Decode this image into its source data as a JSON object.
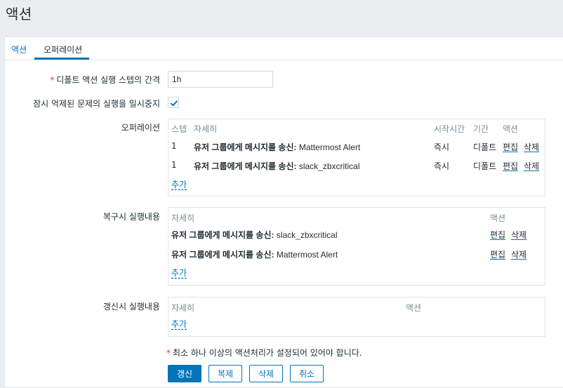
{
  "page": {
    "title": "액션"
  },
  "tabs": [
    {
      "label": "액션",
      "active": false
    },
    {
      "label": "오퍼레이션",
      "active": true
    }
  ],
  "form": {
    "step_duration": {
      "label": "디폴트 액션 실행 스텝의 간격",
      "value": "1h",
      "required": true
    },
    "pause_suppressed": {
      "label": "잠시 억제된 문제의 실행을 일시중지",
      "checked": true
    },
    "operations": {
      "label": "오퍼레이션",
      "headers": {
        "step": "스텝",
        "details": "자세히",
        "start_in": "시작시간",
        "duration": "기간",
        "action": "액션"
      },
      "rows": [
        {
          "step": "1",
          "details_prefix": "유저 그룹에게 메시지를 송신:",
          "details_target": " Mattermost Alert",
          "start_in": "즉시",
          "duration": "디폴트",
          "edit": "편집",
          "remove": "삭제"
        },
        {
          "step": "1",
          "details_prefix": "유저 그룹에게 메시지를 송신:",
          "details_target": " slack_zbxcritical",
          "start_in": "즉시",
          "duration": "디폴트",
          "edit": "편집",
          "remove": "삭제"
        }
      ],
      "add": "추가"
    },
    "recovery": {
      "label": "복구시 실행내용",
      "headers": {
        "details": "자세히",
        "action": "액션"
      },
      "rows": [
        {
          "details_prefix": "유저 그룹에게 메시지를 송신:",
          "details_target": " slack_zbxcritical",
          "edit": "편집",
          "remove": "삭제"
        },
        {
          "details_prefix": "유저 그룹에게 메시지를 송신:",
          "details_target": " Mattermost Alert",
          "edit": "편집",
          "remove": "삭제"
        }
      ],
      "add": "추가"
    },
    "update": {
      "label": "갱신시 실행내용",
      "headers": {
        "details": "자세히",
        "action": "액션"
      },
      "add": "추가"
    },
    "note": "최소 하나 이상의 액션처리가 설정되어 있어야 합니다."
  },
  "buttons": {
    "update": "갱신",
    "clone": "복제",
    "delete": "삭제",
    "cancel": "취소"
  },
  "colors": {
    "accent": "#0275b8",
    "required": "#e33734",
    "header_text": "#768d99"
  }
}
